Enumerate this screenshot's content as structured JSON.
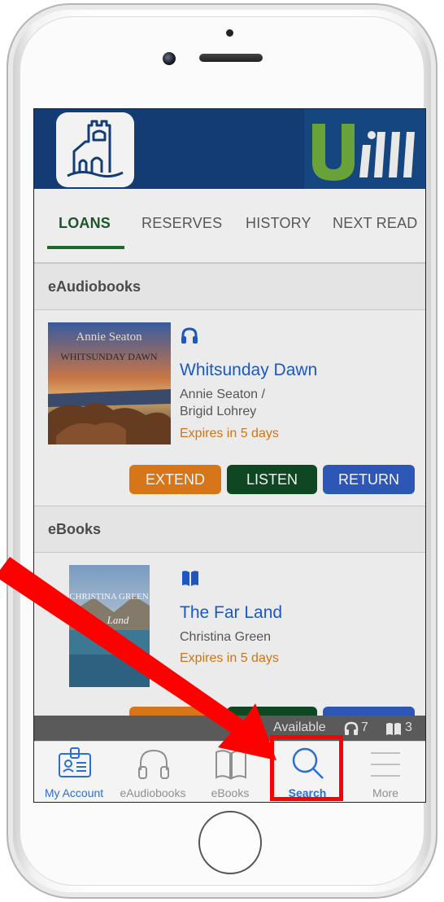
{
  "header": {
    "app_logo_icon": "castle-icon",
    "brand_logo_text": "U"
  },
  "tabs": [
    {
      "label": "LOANS",
      "active": true
    },
    {
      "label": "RESERVES",
      "active": false
    },
    {
      "label": "HISTORY",
      "active": false
    },
    {
      "label": "NEXT READ",
      "active": false
    }
  ],
  "sections": {
    "eaudiobooks": {
      "heading": "eAudiobooks",
      "item": {
        "format_icon": "headphones-icon",
        "cover_author": "Annie Seaton",
        "cover_title": "WHITSUNDAY DAWN",
        "title": "Whitsunday Dawn",
        "author_line1": "Annie Seaton /",
        "author_line2": "Brigid Lohrey",
        "expiry": "Expires in 5 days",
        "buttons": {
          "extend": "EXTEND",
          "listen": "LISTEN",
          "return": "RETURN"
        }
      }
    },
    "ebooks": {
      "heading": "eBooks",
      "item": {
        "format_icon": "open-book-icon",
        "cover_author": "CHRISTINA GREEN",
        "cover_title": "Land",
        "title": "The Far Land",
        "author": "Christina Green",
        "expiry": "Expires in 5 days"
      }
    }
  },
  "status_bar": {
    "label": "Available",
    "audio_count": "7",
    "ebook_count": "3"
  },
  "bottom_nav": [
    {
      "label": "My Account",
      "icon": "id-card-icon"
    },
    {
      "label": "eAudiobooks",
      "icon": "headphones-icon"
    },
    {
      "label": "eBooks",
      "icon": "book-icon"
    },
    {
      "label": "Search",
      "icon": "search-icon"
    },
    {
      "label": "More",
      "icon": "menu-icon"
    }
  ],
  "colors": {
    "header_bg": "#123c73",
    "accent_green": "#1f6d2e",
    "accent_orange": "#e07b1b",
    "accent_blue": "#2f5bbf",
    "annotation_red": "#ff0000"
  }
}
